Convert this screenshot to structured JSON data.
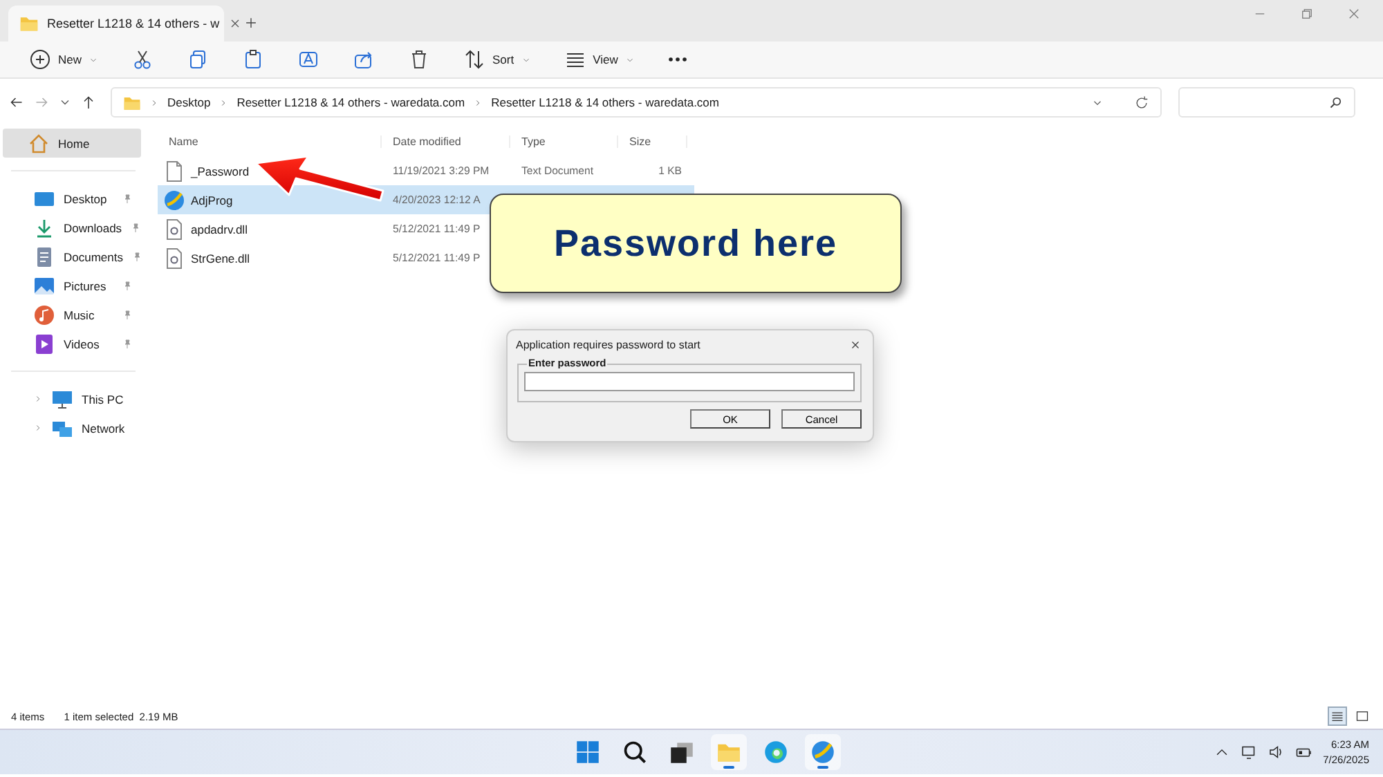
{
  "tab": {
    "title": "Resetter L1218 & 14 others - w"
  },
  "toolbar": [
    {
      "kind": "new",
      "label": "New"
    },
    {
      "kind": "cut"
    },
    {
      "kind": "copy"
    },
    {
      "kind": "paste"
    },
    {
      "kind": "rename"
    },
    {
      "kind": "share"
    },
    {
      "kind": "delete"
    },
    {
      "kind": "sort",
      "label": "Sort"
    },
    {
      "kind": "view",
      "label": "View"
    },
    {
      "kind": "more"
    }
  ],
  "breadcrumb": [
    "Desktop",
    "Resetter L1218 & 14 others - waredata.com",
    "Resetter L1218 & 14 others - waredata.com"
  ],
  "sidebar": {
    "top": [
      {
        "label": "Home",
        "kind": "home",
        "selected": true
      }
    ],
    "quick": [
      {
        "label": "Desktop",
        "kind": "desktop",
        "selected": false
      },
      {
        "label": "Downloads",
        "kind": "downloads",
        "selected": false
      },
      {
        "label": "Documents",
        "kind": "documents",
        "selected": false
      },
      {
        "label": "Pictures",
        "kind": "pictures",
        "selected": false
      },
      {
        "label": "Music",
        "kind": "music",
        "selected": false
      },
      {
        "label": "Videos",
        "kind": "videos",
        "selected": false
      }
    ],
    "drives": [
      {
        "label": "This PC",
        "kind": "pc",
        "selected": false
      },
      {
        "label": "Network",
        "kind": "network",
        "selected": false
      }
    ]
  },
  "table": {
    "columns": [
      "Name",
      "Date modified",
      "Type",
      "Size"
    ],
    "rows": [
      {
        "name": "_Password",
        "kind": "text",
        "date": "11/19/2021 3:29 PM",
        "type": "Text Document",
        "size": "1 KB",
        "selected": false
      },
      {
        "name": "AdjProg",
        "kind": "app",
        "date": "4/20/2023 12:12 A",
        "selected": true
      },
      {
        "name": "apdadrv.dll",
        "kind": "dll",
        "date": "5/12/2021 11:49 P",
        "selected": false
      },
      {
        "name": "StrGene.dll",
        "kind": "dll",
        "date": "5/12/2021 11:49 P",
        "selected": false
      }
    ]
  },
  "status_bar": {
    "items": "4 items",
    "selection": "1 item selected  2.19 MB"
  },
  "callout": {
    "text": "Password here"
  },
  "dialog": {
    "title": "Application requires password to start",
    "group": "Enter password",
    "buttons": [
      "OK",
      "Cancel"
    ]
  },
  "taskbar": {
    "apps": [
      {
        "kind": "start",
        "active": false
      },
      {
        "kind": "search",
        "active": false
      },
      {
        "kind": "taskview",
        "active": false
      },
      {
        "kind": "explorer",
        "active": true
      },
      {
        "kind": "edge",
        "active": false
      },
      {
        "kind": "adjprog",
        "active": true
      }
    ],
    "time": "6:23 AM",
    "date": "7/26/2025"
  }
}
